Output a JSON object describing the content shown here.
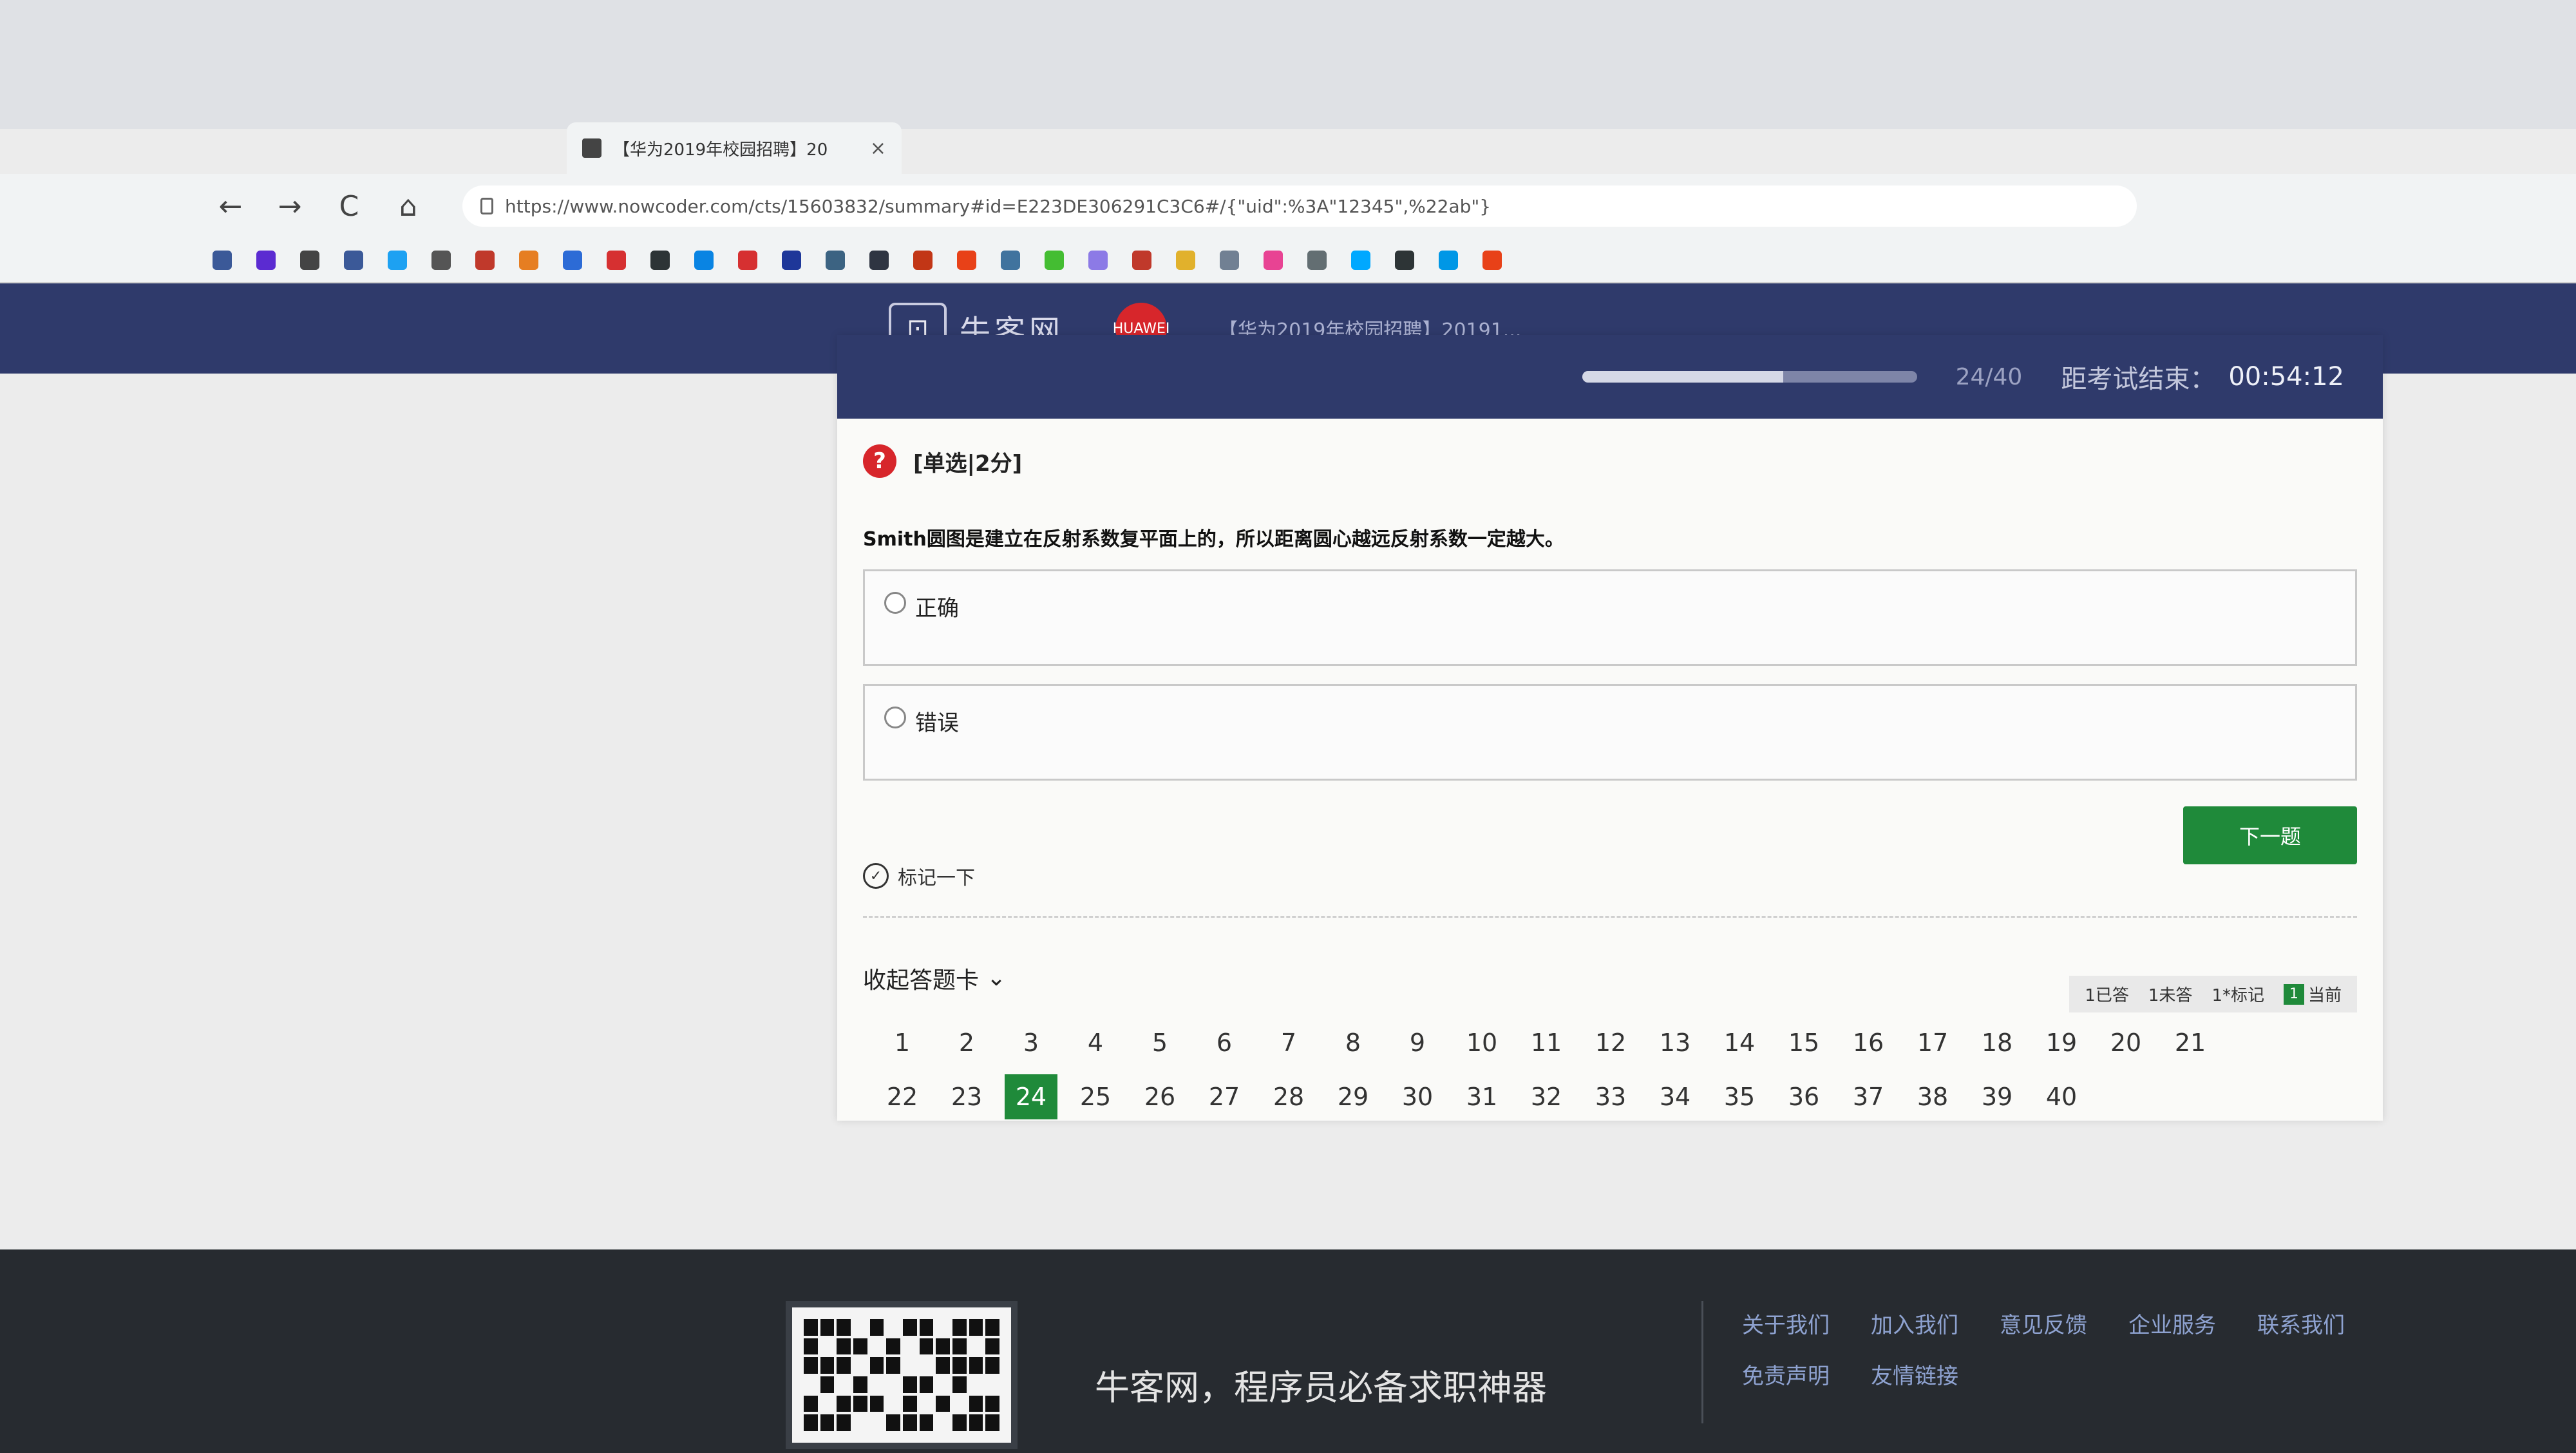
{
  "browser": {
    "tab_title": "【华为2019年校园招聘】20",
    "tab_close": "×",
    "url": "https://www.nowcoder.com/cts/15603832/summary#id=E223DE306291C3C6#/{\"uid\":%3A\"12345\",%22ab\"}",
    "nav_back": "←",
    "nav_forward": "→",
    "nav_reload": "C",
    "nav_home": "⌂"
  },
  "site": {
    "logo_text": "牛客网",
    "logo_mark": "⊡",
    "partner_logo_text": "HUAWEI",
    "exam_title": "【华为2019年校园招聘】20191..."
  },
  "exam": {
    "progress_text": "24/40",
    "progress_fraction": 0.6,
    "timer_label": "距考试结束：",
    "timer_value": "00:54:12",
    "question_icon": "?",
    "question_type": "[单选|2分]",
    "question_text": "Smith圆图是建立在反射系数复平面上的，所以距离圆心越远反射系数一定越大。",
    "options": [
      {
        "label": "正确"
      },
      {
        "label": "错误"
      }
    ],
    "next_button": "下一题",
    "mark_label": "标记一下",
    "mark_icon": "✓"
  },
  "answer_card": {
    "toggle_label": "收起答题卡",
    "toggle_icon": "⌄",
    "legend": {
      "answered": "1已答",
      "unanswered": "1未答",
      "marked": "1*标记",
      "current_box": "1",
      "current": "当前"
    },
    "numbers": [
      "1",
      "2",
      "3",
      "4",
      "5",
      "6",
      "7",
      "8",
      "9",
      "10",
      "11",
      "12",
      "13",
      "14",
      "15",
      "16",
      "17",
      "18",
      "19",
      "20",
      "21",
      "22",
      "23",
      "24",
      "25",
      "26",
      "27",
      "28",
      "29",
      "30",
      "31",
      "32",
      "33",
      "34",
      "35",
      "36",
      "37",
      "38",
      "39",
      "40"
    ],
    "current": "24",
    "accent_color": "#1f8a3a"
  },
  "footer": {
    "slogan": "牛客网，程序员必备求职神器",
    "links": [
      "关于我们",
      "加入我们",
      "意见反馈",
      "企业服务",
      "联系我们",
      "免责声明",
      "友情链接"
    ]
  }
}
